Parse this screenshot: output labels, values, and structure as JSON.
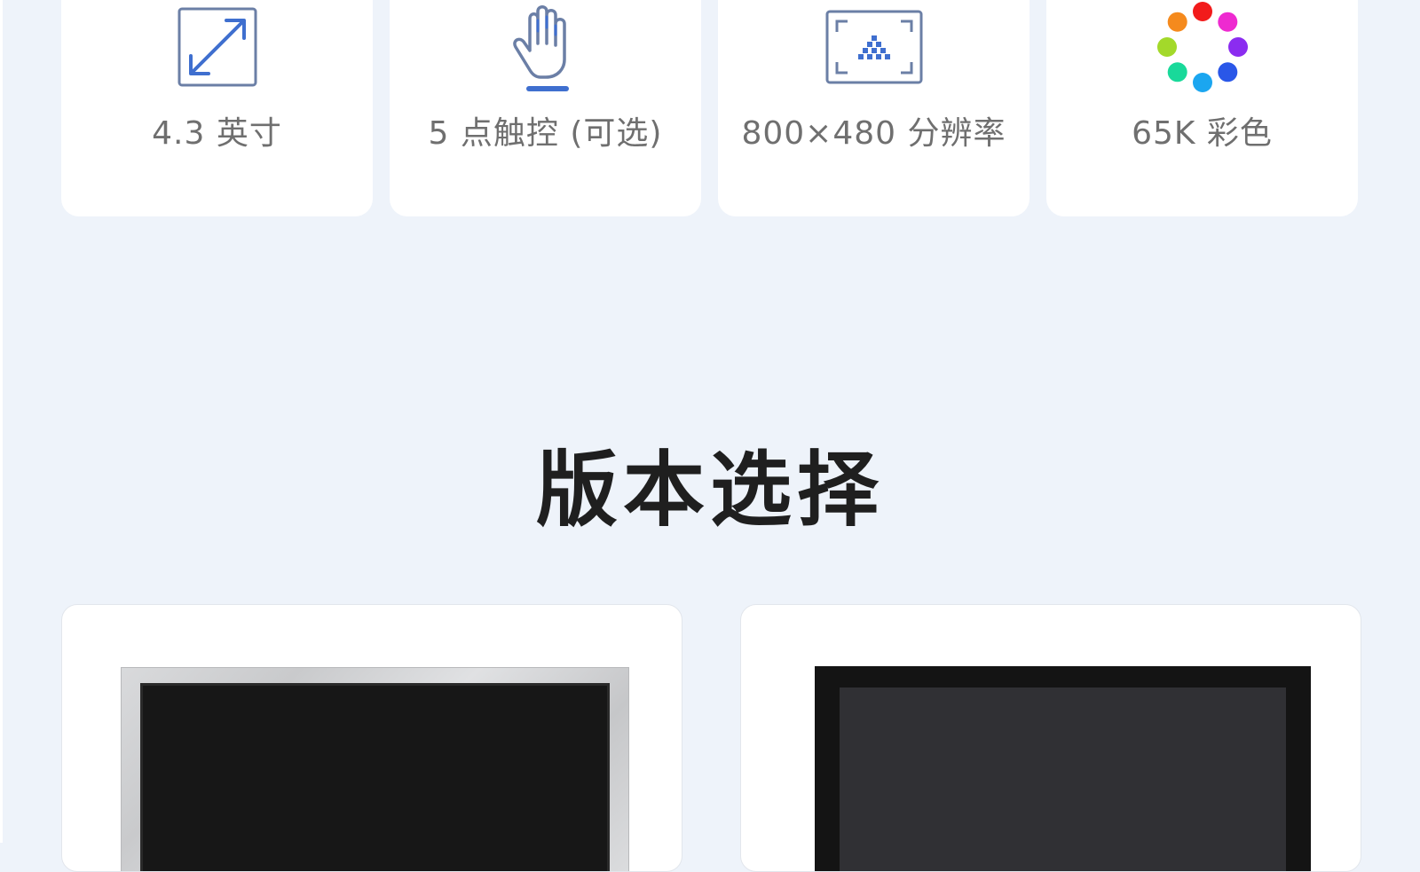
{
  "colors": {
    "background": "#eef3fa",
    "card": "#ffffff",
    "icon_blue": "#3f6fcf",
    "label_gray": "#6f6f6f",
    "title": "#1f1f1f"
  },
  "features": [
    {
      "icon": "resize-diagonal-icon",
      "label": "4.3 英寸"
    },
    {
      "icon": "hand-touch-icon",
      "label": "5 点触控 (可选)"
    },
    {
      "icon": "resolution-screen-icon",
      "label": "800×480 分辨率"
    },
    {
      "icon": "color-wheel-icon",
      "label": "65K 彩色"
    }
  ],
  "color_dots": [
    "#f21b1b",
    "#ee2ad0",
    "#8b2cf0",
    "#2a57e8",
    "#1ba6f0",
    "#19d99a",
    "#a3d92a",
    "#f58a1d"
  ],
  "section": {
    "title": "版本选择"
  },
  "versions": [
    {
      "image": "display-module-silver-frame"
    },
    {
      "image": "display-module-black-frame"
    }
  ]
}
